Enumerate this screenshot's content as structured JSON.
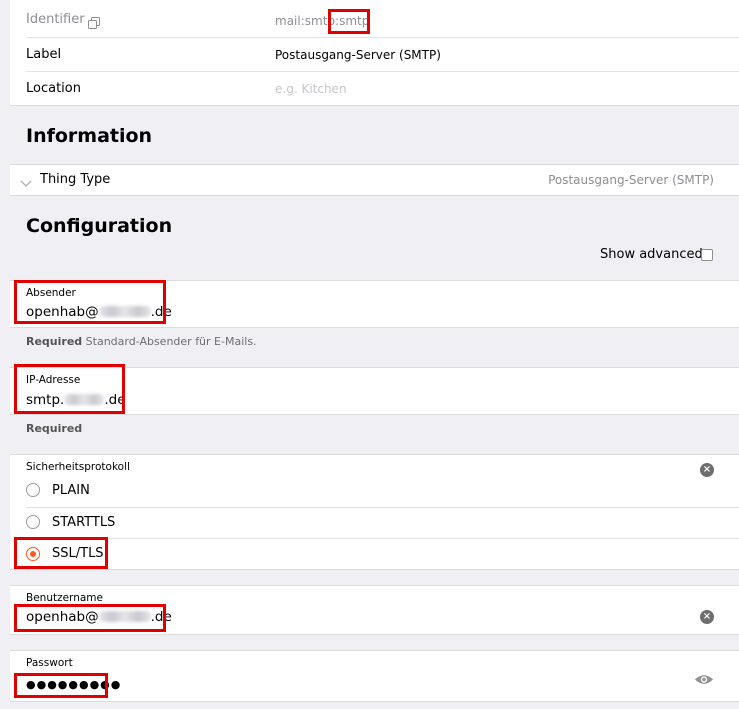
{
  "identifier": {
    "label": "Identifier",
    "value_prefix": "mail:smtp:",
    "value_suffix": "smtp"
  },
  "label_row": {
    "label": "Label",
    "value": "Postausgang-Server (SMTP)"
  },
  "location_row": {
    "label": "Location",
    "placeholder": "e.g. Kitchen"
  },
  "information": {
    "heading": "Information",
    "thing_type_label": "Thing Type",
    "thing_type_value": "Postausgang-Server (SMTP)"
  },
  "configuration": {
    "heading": "Configuration",
    "show_advanced": "Show advanced",
    "sender": {
      "label": "Absender",
      "value_start": "openhab@",
      "value_end": ".de",
      "hint_required": "Required",
      "hint_text": "Standard-Absender für E-Mails."
    },
    "ip": {
      "label": "IP-Adresse",
      "value_start": "smtp.",
      "value_end": ".de",
      "hint_required": "Required"
    },
    "security": {
      "label": "Sicherheitsprotokoll",
      "options": [
        "PLAIN",
        "STARTTLS",
        "SSL/TLS"
      ],
      "selected": "SSL/TLS"
    },
    "username": {
      "label": "Benutzername",
      "value_start": "openhab@",
      "value_end": ".de"
    },
    "password": {
      "label": "Passwort",
      "value": "●●●●●●●●●"
    }
  },
  "colors": {
    "highlight": "#e00000",
    "accent": "#ff5722",
    "background": "#efeff4"
  },
  "icons": [
    "copy-icon",
    "chevron-down-icon",
    "clear-icon",
    "eye-icon"
  ]
}
